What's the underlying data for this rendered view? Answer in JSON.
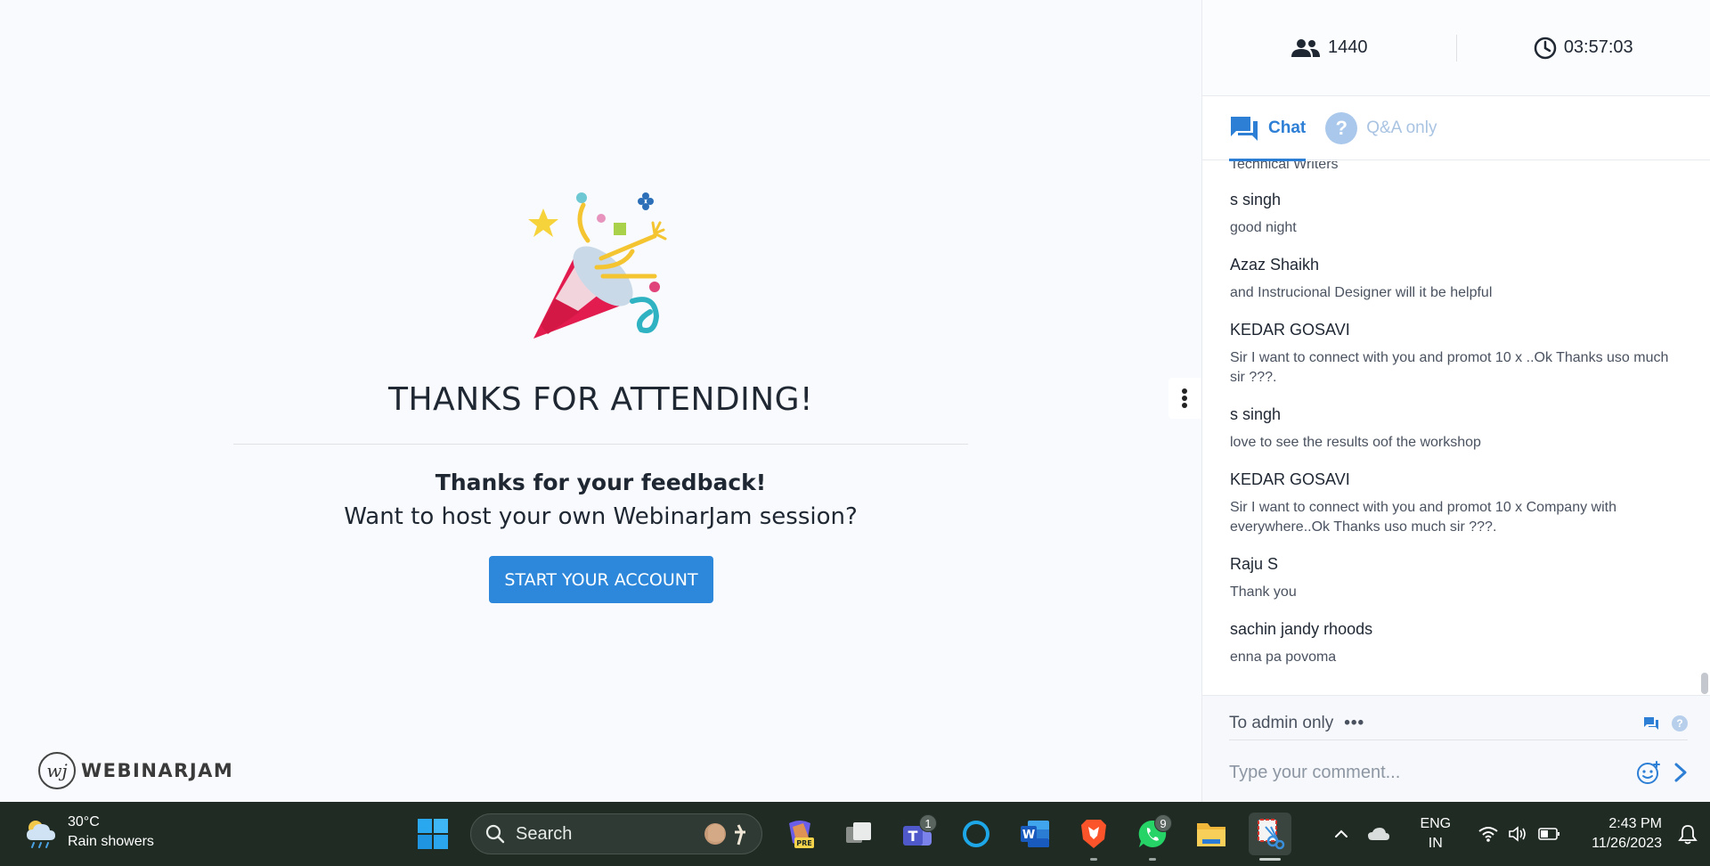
{
  "main": {
    "title": "THANKS FOR ATTENDING!",
    "feedback": "Thanks for your feedback!",
    "host_prompt": "Want to host your own WebinarJam session?",
    "cta_label": "START YOUR ACCOUNT",
    "logo_text": "WEBINARJAM",
    "logo_mark": "wj"
  },
  "sidebar": {
    "attendee_count": "1440",
    "timer": "03:57:03",
    "tabs": [
      {
        "label": "Chat",
        "active": true
      },
      {
        "label": "Q&A only",
        "active": false
      }
    ],
    "partial_message": "Technical Writers",
    "messages": [
      {
        "name": "s singh",
        "text": "good night"
      },
      {
        "name": "Azaz Shaikh",
        "text": "and Instrucional Designer will it be helpful"
      },
      {
        "name": "KEDAR GOSAVI",
        "text": "Sir I want to connect with you and promot 10 x ..Ok Thanks uso much sir ???."
      },
      {
        "name": "s singh",
        "text": "love to see the results oof the workshop"
      },
      {
        "name": "KEDAR GOSAVI",
        "text": "Sir I want to connect with you and promot 10 x Company with everywhere..Ok Thanks uso much sir ???."
      },
      {
        "name": "Raju S",
        "text": "Thank you"
      },
      {
        "name": "sachin jandy rhoods",
        "text": "enna pa povoma"
      }
    ],
    "recipient": "To admin only",
    "more_glyph": "•••",
    "comment_placeholder": "Type your comment..."
  },
  "taskbar": {
    "temperature": "30°C",
    "weather": "Rain showers",
    "search_label": "Search",
    "teams_badge": "1",
    "whatsapp_badge": "9",
    "word_letter": "W",
    "teams_letter": "T",
    "copilot_tag": "PRE",
    "lang_line1": "ENG",
    "lang_line2": "IN",
    "time": "2:43 PM",
    "date": "11/26/2023"
  },
  "colors": {
    "accent": "#2d88db",
    "tab_active": "#2d7fd6",
    "taskbar_bg": "#1f2b23"
  }
}
